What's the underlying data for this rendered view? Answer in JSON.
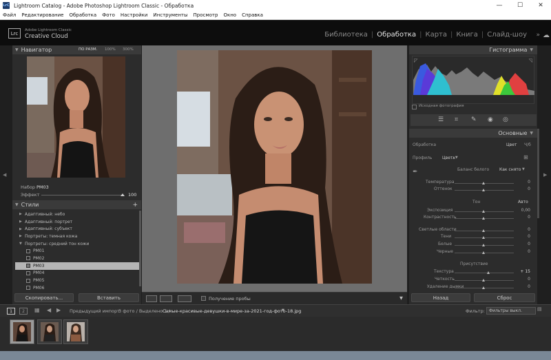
{
  "window": {
    "title": "Lightroom Catalog - Adobe Photoshop Lightroom Classic - Обработка",
    "app_badge": "LrC",
    "controls": [
      "—",
      "☐",
      "✕"
    ]
  },
  "menu": [
    "Файл",
    "Редактирование",
    "Обработка",
    "Фото",
    "Настройки",
    "Инструменты",
    "Просмотр",
    "Окно",
    "Справка"
  ],
  "identity": {
    "badge": "Lrc",
    "line1": "Adobe Lightroom Classic",
    "line2": "Creative Cloud"
  },
  "modules": [
    "Библиотека",
    "Обработка",
    "Карта",
    "Книга",
    "Слайд-шоу"
  ],
  "active_module": "Обработка",
  "navigator": {
    "title": "Навигатор",
    "zoom_options": [
      "ПО РАЗМ.",
      "100%",
      "300%"
    ]
  },
  "preset_info": {
    "set_label": "Набор",
    "set_value": "PM03",
    "amount_label": "Эффект",
    "amount_value": "100",
    "amount_fraction": 1.0
  },
  "styles": {
    "title": "Стили",
    "add": "+",
    "groups": [
      "Адаптивный: небо",
      "Адаптивный: портрет",
      "Адаптивный: субъект",
      "Портреты: темная кожа",
      "Портреты: средний тон кожи"
    ],
    "presets": [
      "PM01",
      "PM02",
      "PM03",
      "PM04",
      "PM05",
      "PM06"
    ],
    "selected_preset": "PM03"
  },
  "left_buttons": {
    "copy": "Скопировать...",
    "paste": "Вставить"
  },
  "toolbar": {
    "soft_proof_label": "Получение пробы"
  },
  "histogram": {
    "title": "Гистограмма",
    "original_photo_label": "Исходная фотография"
  },
  "basic": {
    "title": "Основные",
    "treatment_label": "Обработка",
    "treatment_value": "Цвет",
    "treatment_alt": "Ч/б",
    "profile_label": "Профиль",
    "profile_value": "Цвет",
    "wb_label": "Баланс белого",
    "wb_value": "Как снято",
    "temp_label": "Температура",
    "temp_value": "0",
    "tint_label": "Оттенок",
    "tint_value": "0",
    "tone_label": "Тон",
    "tone_auto": "Авто",
    "exposure_label": "Экспозиция",
    "exposure_value": "0,00",
    "contrast_label": "Контрастность",
    "contrast_value": "0",
    "highlights_label": "Светлые области",
    "highlights_value": "0",
    "shadows_label": "Тени",
    "shadows_value": "0",
    "whites_label": "Белые",
    "whites_value": "0",
    "blacks_label": "Черные",
    "blacks_value": "0",
    "presence_label": "Присутствие",
    "texture_label": "Текстура",
    "texture_value": "+ 15",
    "clarity_label": "Четкость",
    "clarity_value": "0",
    "dehaze_label": "Удаление дымки",
    "dehaze_value": "0"
  },
  "right_buttons": {
    "previous": "Назад",
    "reset": "Сброс"
  },
  "filmstrip": {
    "page1": "1",
    "page2": "2",
    "source": "Предыдущий импорт",
    "info": "3 фото / Выделено 1 /",
    "filename": "Самые-красивые-девушки-в-мире-за-2021-год-фото-18.jpg",
    "filter_label": "Фильтр:",
    "filter_value": "Фильтры выкл."
  },
  "colors": {
    "accent": "#e6e6e6",
    "panel": "#2c2c2c",
    "center": "#6e6e6e"
  }
}
